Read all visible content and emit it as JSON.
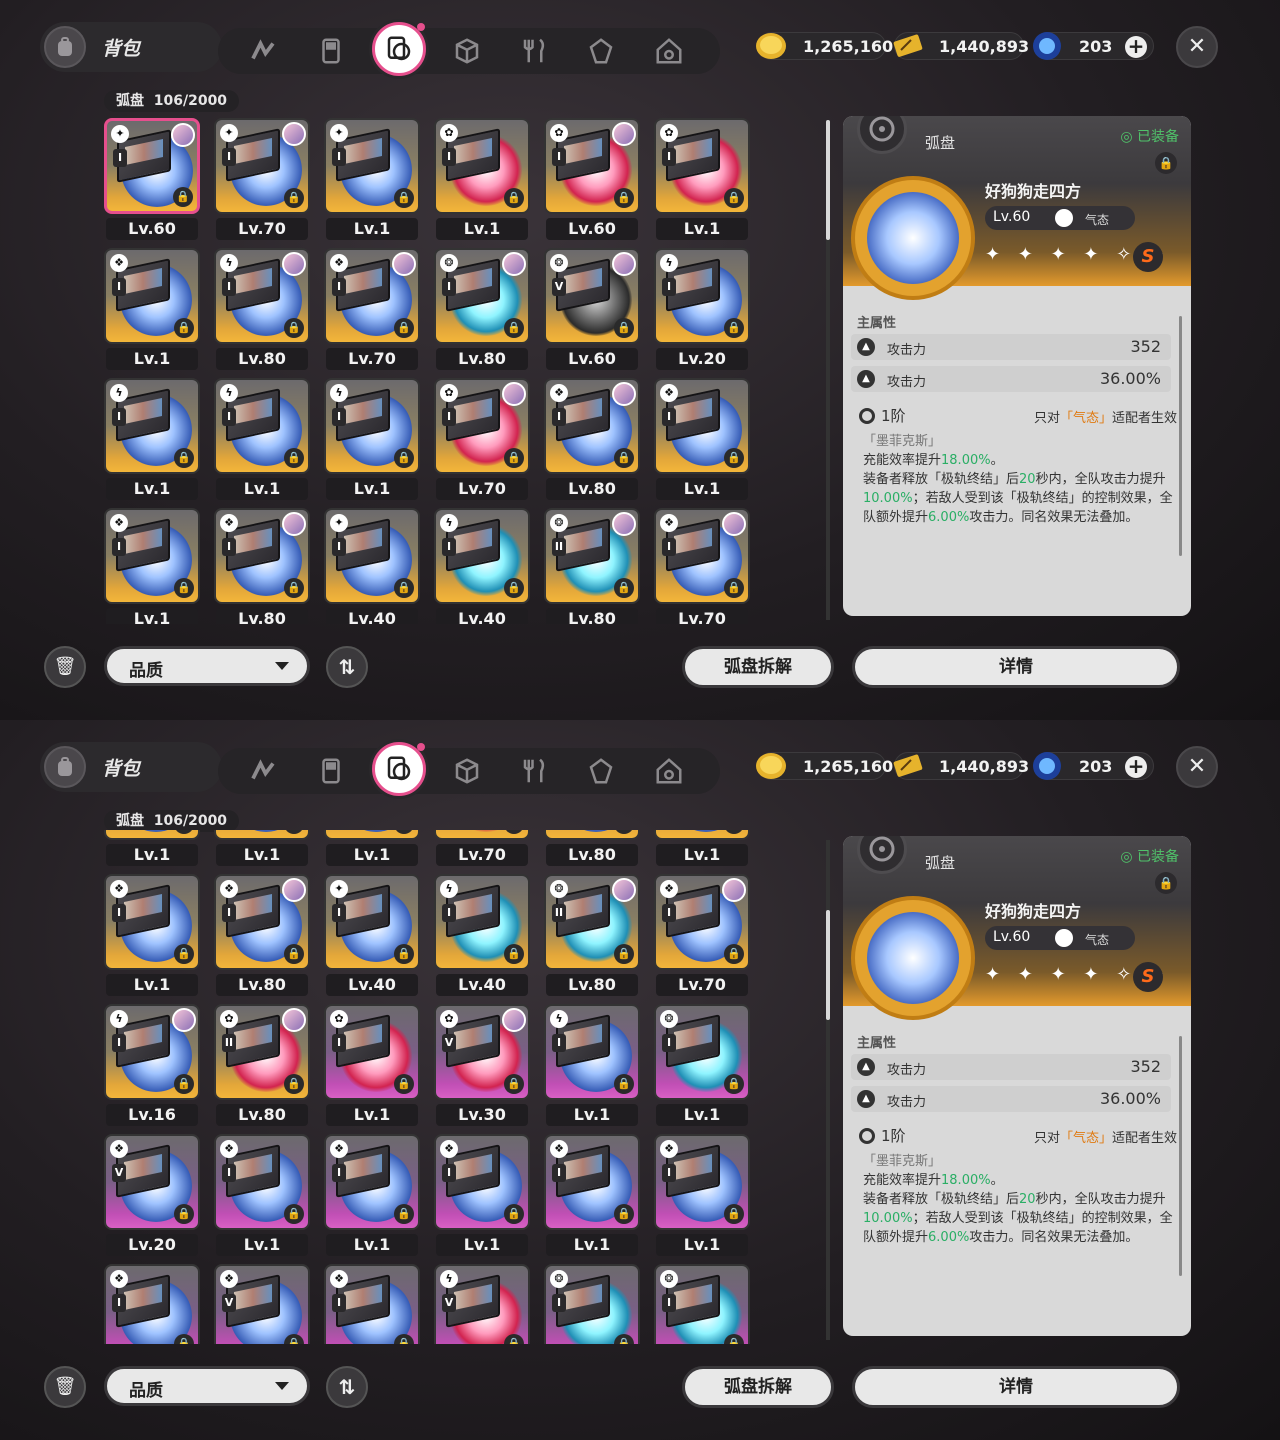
{
  "header": {
    "title": "背包",
    "tabs": [
      {
        "name": "agent-tab",
        "icon": "n-logo-icon",
        "active": false
      },
      {
        "name": "device-tab",
        "icon": "gameboy-icon",
        "active": false
      },
      {
        "name": "disc-tab",
        "icon": "disc-card-icon",
        "active": true
      },
      {
        "name": "box-tab",
        "icon": "cube-icon",
        "active": false
      },
      {
        "name": "food-tab",
        "icon": "fork-knife-icon",
        "active": false
      },
      {
        "name": "material-tab",
        "icon": "crystal-icon",
        "active": false
      },
      {
        "name": "home-tab",
        "icon": "home-icon",
        "active": false
      }
    ],
    "currencies": [
      {
        "name": "dennies",
        "icon": "gold-coin-icon",
        "value": "1,265,160"
      },
      {
        "name": "ticket",
        "icon": "ticket-icon",
        "value": "1,440,893"
      },
      {
        "name": "polychrome",
        "icon": "blue-gem-icon",
        "value": "203"
      }
    ],
    "close": "✕"
  },
  "inventory": {
    "label": "弧盘",
    "count": "106/2000"
  },
  "screen1_items": [
    {
      "lv": "Lv.60",
      "attr": "✦",
      "rank": "I",
      "color": "gold",
      "disc": "blue",
      "avatar": true,
      "selected": true
    },
    {
      "lv": "Lv.70",
      "attr": "✦",
      "rank": "I",
      "color": "gold",
      "disc": "blue",
      "avatar": true
    },
    {
      "lv": "Lv.1",
      "attr": "✦",
      "rank": "I",
      "color": "gold",
      "disc": "blue",
      "avatar": false
    },
    {
      "lv": "Lv.1",
      "attr": "✿",
      "rank": "I",
      "color": "gold",
      "disc": "red",
      "avatar": false
    },
    {
      "lv": "Lv.60",
      "attr": "✿",
      "rank": "I",
      "color": "gold",
      "disc": "red",
      "avatar": true
    },
    {
      "lv": "Lv.1",
      "attr": "✿",
      "rank": "I",
      "color": "gold",
      "disc": "red",
      "avatar": false
    },
    {
      "lv": "Lv.1",
      "attr": "❖",
      "rank": "I",
      "color": "gold",
      "disc": "blue",
      "avatar": false
    },
    {
      "lv": "Lv.80",
      "attr": "ϟ",
      "rank": "I",
      "color": "gold",
      "disc": "blue",
      "avatar": true
    },
    {
      "lv": "Lv.70",
      "attr": "❖",
      "rank": "I",
      "color": "gold",
      "disc": "blue",
      "avatar": true
    },
    {
      "lv": "Lv.80",
      "attr": "❂",
      "rank": "I",
      "color": "gold",
      "disc": "cyan",
      "avatar": true
    },
    {
      "lv": "Lv.60",
      "attr": "❂",
      "rank": "V",
      "color": "gold",
      "disc": "dark",
      "avatar": true
    },
    {
      "lv": "Lv.20",
      "attr": "ϟ",
      "rank": "I",
      "color": "gold",
      "disc": "blue",
      "avatar": false
    },
    {
      "lv": "Lv.1",
      "attr": "ϟ",
      "rank": "I",
      "color": "gold",
      "disc": "blue",
      "avatar": false
    },
    {
      "lv": "Lv.1",
      "attr": "ϟ",
      "rank": "I",
      "color": "gold",
      "disc": "blue",
      "avatar": false
    },
    {
      "lv": "Lv.1",
      "attr": "ϟ",
      "rank": "I",
      "color": "gold",
      "disc": "blue",
      "avatar": false
    },
    {
      "lv": "Lv.70",
      "attr": "✿",
      "rank": "I",
      "color": "gold",
      "disc": "red",
      "avatar": true
    },
    {
      "lv": "Lv.80",
      "attr": "❖",
      "rank": "I",
      "color": "gold",
      "disc": "blue",
      "avatar": true
    },
    {
      "lv": "Lv.1",
      "attr": "❖",
      "rank": "I",
      "color": "gold",
      "disc": "blue",
      "avatar": false
    },
    {
      "lv": "Lv.1",
      "attr": "❖",
      "rank": "I",
      "color": "gold",
      "disc": "blue",
      "avatar": false
    },
    {
      "lv": "Lv.80",
      "attr": "❖",
      "rank": "I",
      "color": "gold",
      "disc": "blue",
      "avatar": true
    },
    {
      "lv": "Lv.40",
      "attr": "✦",
      "rank": "I",
      "color": "gold",
      "disc": "blue",
      "avatar": false
    },
    {
      "lv": "Lv.40",
      "attr": "ϟ",
      "rank": "I",
      "color": "gold",
      "disc": "cyan",
      "avatar": false
    },
    {
      "lv": "Lv.80",
      "attr": "❂",
      "rank": "II",
      "color": "gold",
      "disc": "cyan",
      "avatar": true
    },
    {
      "lv": "Lv.70",
      "attr": "❖",
      "rank": "I",
      "color": "gold",
      "disc": "blue",
      "avatar": true
    }
  ],
  "screen2_items": [
    {
      "lv": "Lv.1",
      "attr": "ϟ",
      "rank": "I",
      "color": "gold",
      "disc": "blue",
      "avatar": false
    },
    {
      "lv": "Lv.1",
      "attr": "ϟ",
      "rank": "I",
      "color": "gold",
      "disc": "blue",
      "avatar": false
    },
    {
      "lv": "Lv.1",
      "attr": "ϟ",
      "rank": "I",
      "color": "gold",
      "disc": "blue",
      "avatar": false
    },
    {
      "lv": "Lv.70",
      "attr": "✿",
      "rank": "I",
      "color": "gold",
      "disc": "red",
      "avatar": false
    },
    {
      "lv": "Lv.80",
      "attr": "❖",
      "rank": "I",
      "color": "gold",
      "disc": "blue",
      "avatar": false
    },
    {
      "lv": "Lv.1",
      "attr": "❖",
      "rank": "I",
      "color": "gold",
      "disc": "blue",
      "avatar": false
    },
    {
      "lv": "Lv.1",
      "attr": "❖",
      "rank": "I",
      "color": "gold",
      "disc": "blue",
      "avatar": false
    },
    {
      "lv": "Lv.80",
      "attr": "❖",
      "rank": "I",
      "color": "gold",
      "disc": "blue",
      "avatar": true
    },
    {
      "lv": "Lv.40",
      "attr": "✦",
      "rank": "I",
      "color": "gold",
      "disc": "blue",
      "avatar": false
    },
    {
      "lv": "Lv.40",
      "attr": "ϟ",
      "rank": "I",
      "color": "gold",
      "disc": "cyan",
      "avatar": false
    },
    {
      "lv": "Lv.80",
      "attr": "❂",
      "rank": "II",
      "color": "gold",
      "disc": "cyan",
      "avatar": true
    },
    {
      "lv": "Lv.70",
      "attr": "❖",
      "rank": "I",
      "color": "gold",
      "disc": "blue",
      "avatar": true
    },
    {
      "lv": "Lv.16",
      "attr": "ϟ",
      "rank": "I",
      "color": "gold",
      "disc": "blue",
      "avatar": true
    },
    {
      "lv": "Lv.80",
      "attr": "✿",
      "rank": "II",
      "color": "gold",
      "disc": "red",
      "avatar": true
    },
    {
      "lv": "Lv.1",
      "attr": "✿",
      "rank": "I",
      "color": "purple",
      "disc": "red",
      "avatar": false
    },
    {
      "lv": "Lv.30",
      "attr": "✿",
      "rank": "V",
      "color": "purple",
      "disc": "red",
      "avatar": true
    },
    {
      "lv": "Lv.1",
      "attr": "ϟ",
      "rank": "I",
      "color": "purple",
      "disc": "blue",
      "avatar": false
    },
    {
      "lv": "Lv.1",
      "attr": "❂",
      "rank": "I",
      "color": "purple",
      "disc": "cyan",
      "avatar": false
    },
    {
      "lv": "Lv.20",
      "attr": "❖",
      "rank": "V",
      "color": "purple",
      "disc": "blue",
      "avatar": false
    },
    {
      "lv": "Lv.1",
      "attr": "❖",
      "rank": "I",
      "color": "purple",
      "disc": "blue",
      "avatar": false
    },
    {
      "lv": "Lv.1",
      "attr": "❖",
      "rank": "I",
      "color": "purple",
      "disc": "blue",
      "avatar": false
    },
    {
      "lv": "Lv.1",
      "attr": "❖",
      "rank": "I",
      "color": "purple",
      "disc": "blue",
      "avatar": false
    },
    {
      "lv": "Lv.1",
      "attr": "❖",
      "rank": "I",
      "color": "purple",
      "disc": "blue",
      "avatar": false
    },
    {
      "lv": "Lv.1",
      "attr": "❖",
      "rank": "I",
      "color": "purple",
      "disc": "blue",
      "avatar": false
    },
    {
      "lv": "",
      "attr": "❖",
      "rank": "I",
      "color": "purple",
      "disc": "blue",
      "avatar": false
    },
    {
      "lv": "",
      "attr": "❖",
      "rank": "V",
      "color": "purple",
      "disc": "blue",
      "avatar": false
    },
    {
      "lv": "",
      "attr": "❖",
      "rank": "I",
      "color": "purple",
      "disc": "blue",
      "avatar": false
    },
    {
      "lv": "",
      "attr": "ϟ",
      "rank": "V",
      "color": "purple",
      "disc": "red",
      "avatar": false
    },
    {
      "lv": "",
      "attr": "❂",
      "rank": "I",
      "color": "purple",
      "disc": "cyan",
      "avatar": false
    },
    {
      "lv": "",
      "attr": "❂",
      "rank": "I",
      "color": "purple",
      "disc": "cyan",
      "avatar": false
    }
  ],
  "detail": {
    "category": "弧盘",
    "equipped": "◎ 已装备",
    "name": "好狗狗走四方",
    "level": "Lv.60",
    "attribute": "气态",
    "stars": "✦ ✦ ✦ ✦ ✧ ✧",
    "rank_badge": "S",
    "section_main": "主属性",
    "stats": [
      {
        "name": "攻击力",
        "value": "352"
      },
      {
        "name": "攻击力",
        "value": "36.00%"
      }
    ],
    "tier": "1阶",
    "tier_note_prefix": "只对",
    "tier_note_highlight": "「气态」",
    "tier_note_suffix": "适配者生效",
    "desc_title": "「墨菲克斯」",
    "desc_lines": [
      [
        "充能效率提升",
        "18.00%",
        "。"
      ],
      [
        "装备者释放「极轨终结」后",
        "20",
        "秒内，全队攻击力提升",
        "10.00%",
        "；若敌人受到该「极轨终结」的控制效果，全队额外提升",
        "6.00%",
        "攻击力。同名效果无法叠加。"
      ]
    ]
  },
  "footer": {
    "trash": "🗑",
    "sort_label": "品质",
    "sort_order": "⇅",
    "dismantle": "弧盘拆解",
    "details": "详情"
  },
  "colors": {
    "accent": "#e64f8d",
    "gold": "#f3b63a",
    "purple": "#d860c4",
    "green": "#2aae65",
    "orange": "#e07a10"
  }
}
